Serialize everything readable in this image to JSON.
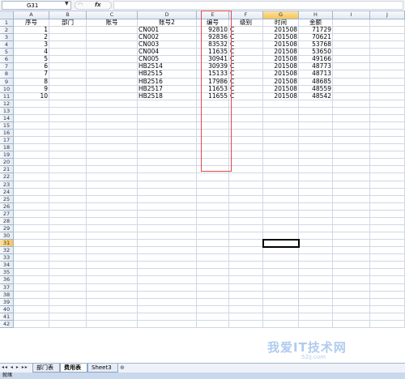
{
  "formula_bar": {
    "name_box": "G31",
    "fx_label": "fx",
    "formula": ""
  },
  "columns": [
    "A",
    "B",
    "C",
    "D",
    "E",
    "F",
    "G",
    "H",
    "I",
    "J"
  ],
  "row_numbers": [
    "1",
    "2",
    "3",
    "4",
    "5",
    "6",
    "7",
    "8",
    "9",
    "10",
    "11",
    "12",
    "13",
    "14",
    "15",
    "16",
    "17",
    "18",
    "19",
    "20",
    "21",
    "22",
    "23",
    "24",
    "25",
    "26",
    "27",
    "28",
    "29",
    "30",
    "31",
    "32",
    "33",
    "34",
    "35",
    "36",
    "37",
    "38",
    "39",
    "40",
    "41",
    "42"
  ],
  "table": {
    "headers": [
      "序号",
      "部门",
      "账号",
      "账号2",
      "编号",
      "级别",
      "时间",
      "金额"
    ],
    "rows": [
      [
        "1",
        "",
        "",
        "CN001",
        "92810",
        "C",
        "201508",
        "71729"
      ],
      [
        "2",
        "",
        "",
        "CN002",
        "92836",
        "C",
        "201508",
        "70621"
      ],
      [
        "3",
        "",
        "",
        "CN003",
        "83532",
        "C",
        "201508",
        "53768"
      ],
      [
        "4",
        "",
        "",
        "CN004",
        "11635",
        "C",
        "201508",
        "53650"
      ],
      [
        "5",
        "",
        "",
        "CN005",
        "30941",
        "C",
        "201508",
        "49166"
      ],
      [
        "6",
        "",
        "",
        "HB2514",
        "30939",
        "C",
        "201508",
        "48773"
      ],
      [
        "7",
        "",
        "",
        "HB2515",
        "15133",
        "C",
        "201508",
        "48713"
      ],
      [
        "8",
        "",
        "",
        "HB2516",
        "17986",
        "C",
        "201508",
        "48685"
      ],
      [
        "9",
        "",
        "",
        "HB2517",
        "11653",
        "C",
        "201508",
        "48559"
      ],
      [
        "10",
        "",
        "",
        "HB2518",
        "11655",
        "C",
        "201508",
        "48542"
      ]
    ]
  },
  "sheet_tabs": [
    {
      "label": "部门表",
      "active": false
    },
    {
      "label": "费用表",
      "active": true
    },
    {
      "label": "Sheet3",
      "active": false
    }
  ],
  "tab_nav_glyphs": "◂◂ ◂ ▸ ▸▸",
  "status_text": "就绪",
  "watermark": {
    "main": "我爱IT技术网",
    "sub": "52ij.com"
  },
  "colors": {
    "selected_header": "#f6c456",
    "highlight_box": "#e0484c",
    "grid_line": "#d0d7e5"
  }
}
